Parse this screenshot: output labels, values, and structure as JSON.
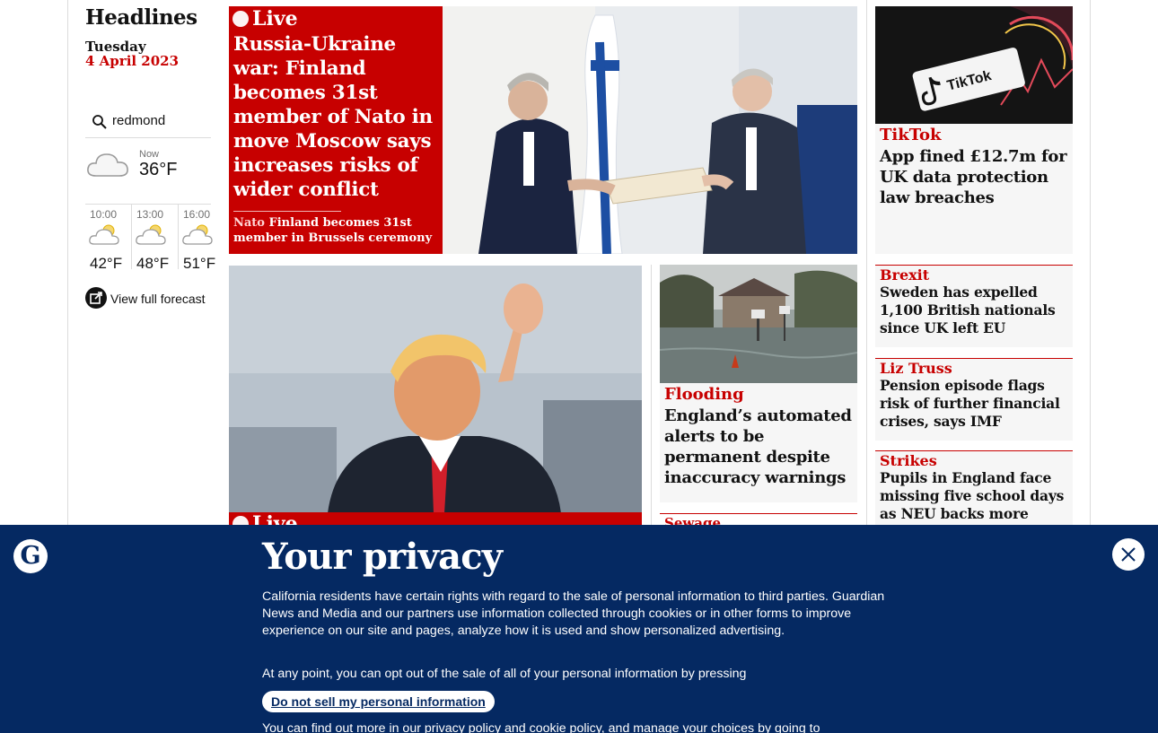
{
  "headlines": {
    "title": "Headlines",
    "day": "Tuesday",
    "date": "4 April 2023"
  },
  "weather": {
    "location": "redmond",
    "now_label": "Now",
    "now_temp": "36°F",
    "forecast": [
      {
        "time": "10:00",
        "temp": "42°F",
        "icon": "sun-cloud-icon"
      },
      {
        "time": "13:00",
        "temp": "48°F",
        "icon": "sun-cloud-icon"
      },
      {
        "time": "16:00",
        "temp": "51°F",
        "icon": "sun-cloud-icon"
      }
    ],
    "full_forecast_label": "View full forecast"
  },
  "main_story": {
    "live_label": "Live",
    "headline": "Russia-Ukraine war: Finland becomes 31st member of Nato in move Moscow says increases risks of wider conflict",
    "sub_kicker": "Nato",
    "sub_text": "Finland becomes 31st member in Brussels ceremony"
  },
  "trump_story": {
    "live_label": "Live"
  },
  "flooding_story": {
    "kicker": "Flooding",
    "headline": "England’s automated alerts to be permanent despite inaccuracy warnings"
  },
  "sewage_story": {
    "kicker": "Sewage"
  },
  "tiktok_story": {
    "kicker": "TikTok",
    "headline": "App fined £12.7m for UK data protection law breaches",
    "image_text": "TikTok"
  },
  "right_stories": [
    {
      "kicker": "Brexit",
      "headline": "Sweden has expelled 1,100 British nationals since UK left EU"
    },
    {
      "kicker": "Liz Truss",
      "headline": "Pension episode flags risk of further financial crises, says IMF"
    },
    {
      "kicker": "Strikes",
      "headline": "Pupils in England face missing five school days as NEU backs more strikes"
    }
  ],
  "privacy": {
    "title": "Your privacy",
    "paragraph1": "California residents have certain rights with regard to the sale of personal information to third parties. Guardian News and Media and our partners use information collected through cookies or in other forms to improve experience on our site and pages, analyze how it is used and show personalized advertising.",
    "paragraph2": "At any point, you can opt out of the sale of all of your personal information by pressing",
    "button_label": "Do not sell my personal information",
    "p3_start": "You can find out more in our ",
    "p3_link1": "privacy policy",
    "p3_mid": " and ",
    "p3_link2": "cookie policy",
    "p3_end": ", and manage your choices by going to",
    "logo_letter": "G"
  },
  "colors": {
    "brand_red": "#c70000",
    "banner_navy": "#052962",
    "card_grey": "#f6f6f6"
  }
}
